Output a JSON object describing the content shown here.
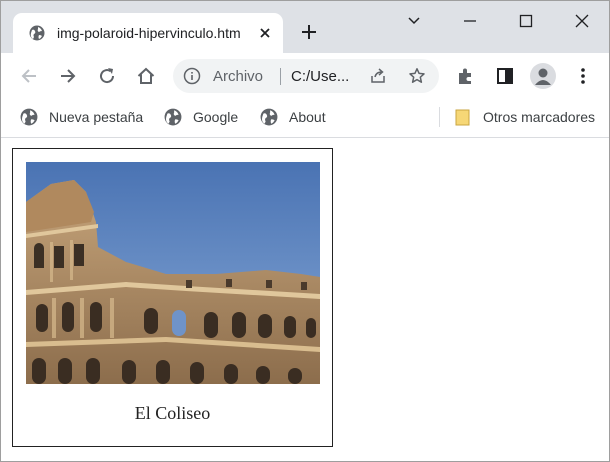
{
  "tab": {
    "title": "img-polaroid-hipervinculo.htm"
  },
  "address": {
    "scheme_label": "Archivo",
    "url": "C:/Use..."
  },
  "bookmarks": [
    {
      "label": "Nueva pestaña",
      "icon": "globe-icon"
    },
    {
      "label": "Google",
      "icon": "globe-icon"
    },
    {
      "label": "About",
      "icon": "globe-icon"
    }
  ],
  "other_bookmarks": {
    "label": "Otros marcadores",
    "icon": "folder-icon"
  },
  "polaroid": {
    "caption": "El Coliseo",
    "image": "colosseum-photo"
  },
  "colors": {
    "tabstrip": "#dee1e6",
    "omnibox": "#f1f3f4",
    "icon": "#5f6368",
    "sky": "#4f79b8",
    "stone": "#b7946b"
  }
}
